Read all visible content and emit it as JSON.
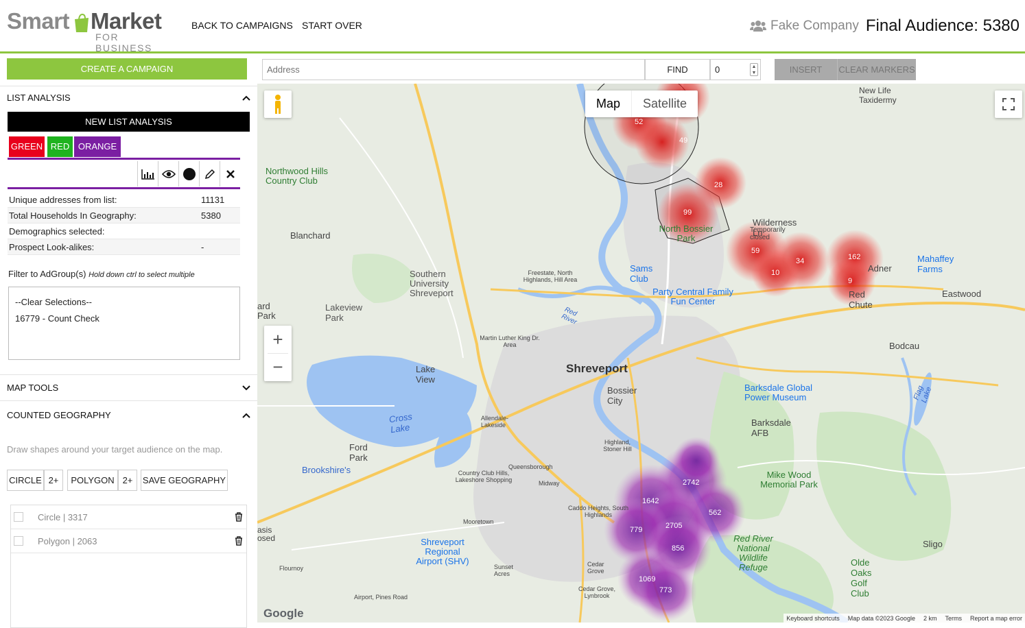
{
  "header": {
    "logo_smart": "Smart",
    "logo_market": "Market",
    "logo_sub": "FOR BUSINESS",
    "nav": [
      "BACK TO CAMPAIGNS",
      "START OVER"
    ],
    "company": "Fake Company",
    "final_audience": "Final Audience: 5380"
  },
  "toolbar": {
    "create_campaign": "CREATE A CAMPAIGN",
    "address_placeholder": "Address",
    "find": "FIND",
    "number_value": "0",
    "insert": "INSERT",
    "clear_markers": "CLEAR MARKERS"
  },
  "list_analysis": {
    "title": "LIST ANALYSIS",
    "new_button": "NEW LIST ANALYSIS",
    "color_buttons": [
      {
        "label": "GREEN",
        "color": "#e8001c"
      },
      {
        "label": "RED",
        "color": "#1fb31f"
      },
      {
        "label": "ORANGE",
        "color": "#7b1fa2"
      }
    ],
    "stats": [
      {
        "label": "Unique addresses from list:",
        "value": "11131"
      },
      {
        "label": "Total Households In Geography:",
        "value": "5380"
      },
      {
        "label": "Demographics selected:",
        "value": ""
      },
      {
        "label": "Prospect Look-alikes:",
        "value": "-"
      }
    ],
    "filter_label": "Filter to AdGroup(s)",
    "filter_hint": "Hold down ctrl to select multiple",
    "options": [
      "--Clear Selections--",
      "16779 - Count Check"
    ]
  },
  "map_tools": {
    "title": "MAP TOOLS"
  },
  "counted_geography": {
    "title": "COUNTED GEOGRAPHY",
    "hint": "Draw shapes around your target audience on the map.",
    "circle": "CIRCLE",
    "circle_count": "2+",
    "polygon": "POLYGON",
    "polygon_count": "2+",
    "save": "SAVE GEOGRAPHY",
    "shapes": [
      "Circle | 3317",
      "Polygon | 2063"
    ]
  },
  "map": {
    "type_map": "Map",
    "type_satellite": "Satellite",
    "zoom_in": "+",
    "zoom_out": "−",
    "footer": [
      "Keyboard shortcuts",
      "Map data ©2023 Google",
      "2 km",
      "Terms",
      "Report a map error"
    ],
    "google": "Google",
    "places": [
      "Northwood Hills Country Club",
      "Blanchard",
      "Southern University Shreveport",
      "Lakeview Park",
      "Lake View",
      "Shreveport",
      "Bossier City",
      "Cross Lake",
      "Ford Park",
      "Brookshire's",
      "Shreveport Regional Airport (SHV)",
      "Sams Club",
      "Party Central Family Fun Center",
      "North Bossier Park",
      "Wilderness Ln",
      "Temporarily closed",
      "Adner",
      "Red Chute",
      "Mahaffey Farms",
      "Eastwood",
      "Bodcau",
      "Barksdale Global Power Museum",
      "Barksdale AFB",
      "Mike Wood Memorial Park",
      "Red River National Wildlife Refuge",
      "Sligo",
      "Olde Oaks Golf Club",
      "New Life Taxidermy",
      "Flag Lake",
      "Red River",
      "Country Club Hills, Lakeshore Shopping",
      "Queensborough",
      "Midway",
      "Caddo Heights, South Highlands",
      "Mooretown",
      "Sunset Acres",
      "Cedar Grove",
      "Cedar Grove, Lynbrook",
      "Airport, Pines Road",
      "Flournoy",
      "Highland, Stoner Hill",
      "Allendale-Lakeside",
      "Martin Luther King Dr. Area",
      "Freestate, North Highlands, Hill Area",
      "ard Park",
      "asis osed"
    ],
    "red_clusters": [
      "52",
      "49",
      "28",
      "99",
      "59",
      "10",
      "34",
      "162",
      "9"
    ],
    "purple_clusters": [
      "2742",
      "1642",
      "562",
      "2705",
      "779",
      "856",
      "1069",
      "773"
    ],
    "colors": {
      "red": "#e8001c",
      "purple": "#8e24aa",
      "water": "#9ec3f2",
      "park": "#c9e4c0",
      "road": "#f7c95c"
    }
  }
}
